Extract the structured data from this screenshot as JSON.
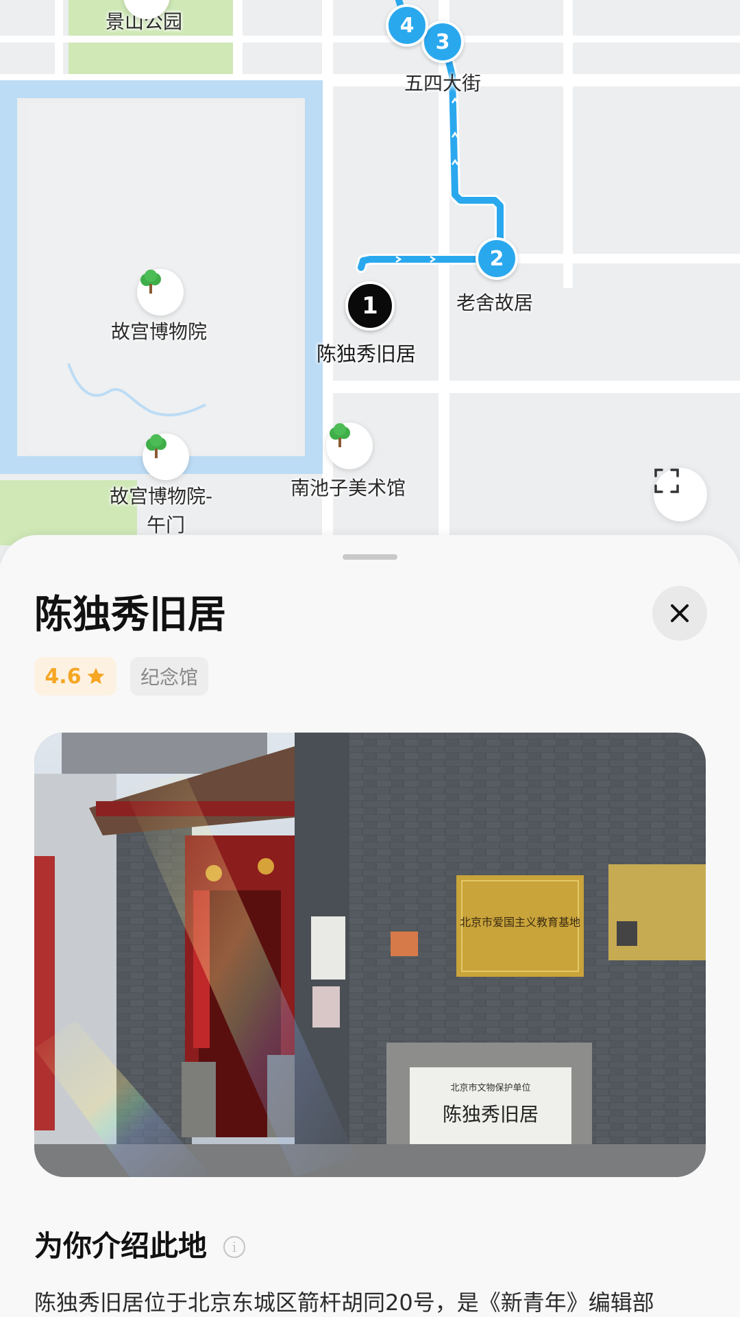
{
  "map": {
    "labels": {
      "jingshan": "景山公园",
      "wusi": "五四大街",
      "laoshe": "老舍故居",
      "gugong": "故宫博物院",
      "chen": "陈独秀旧居",
      "wumen_line1": "故宫博物院-",
      "wumen_line2": "午门",
      "nanchizi": "南池子美术馆"
    },
    "stops": [
      "1",
      "2",
      "3",
      "4"
    ],
    "route_color": "#2aa8ee",
    "park_color": "#cfe8b6",
    "moat_color": "#bcdcf5",
    "icons": {
      "poi": "tree-icon",
      "fullscreen": "fullscreen-icon"
    }
  },
  "sheet": {
    "title": "陈独秀旧居",
    "rating": "4.6",
    "rating_icon": "star-icon",
    "category": "纪念馆",
    "close_icon": "close-icon",
    "photo": {
      "gold_plaque": "北京市爱国主义教育基地",
      "stone_plaque_small": "北京市文物保护单位",
      "stone_plaque_main": "陈独秀旧居"
    },
    "section_title": "为你介绍此地",
    "section_icon": "info-icon",
    "description": "陈独秀旧居位于北京东城区箭杆胡同20号，是《新青年》编辑部"
  },
  "colors": {
    "accent_blue": "#2aa8ee",
    "rating_orange": "#f5a623",
    "rating_bg": "#fdf1e2"
  }
}
